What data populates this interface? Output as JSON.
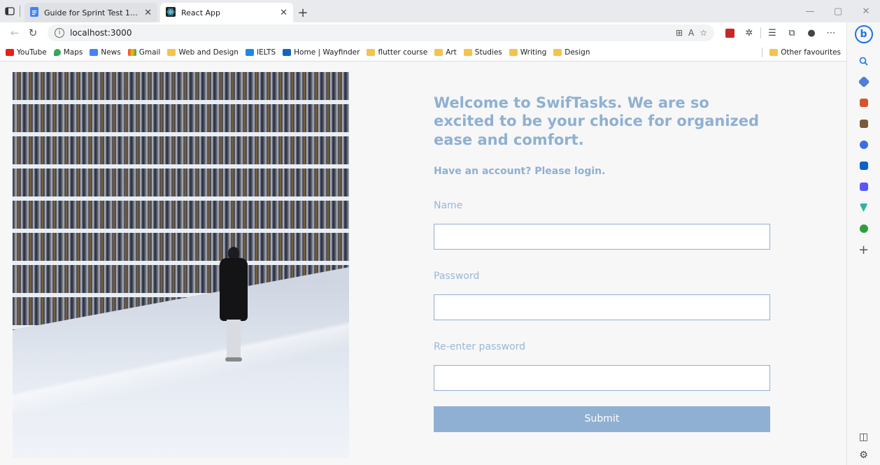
{
  "browser": {
    "tabs": [
      {
        "title": "Guide for Sprint Test 1 - Google D",
        "active": false
      },
      {
        "title": "React App",
        "active": true
      }
    ],
    "address": "localhost:3000",
    "bookmarks": [
      {
        "label": "YouTube",
        "icon": "youtube-icon",
        "color": "#e62117"
      },
      {
        "label": "Maps",
        "icon": "maps-icon",
        "color": "#34a853"
      },
      {
        "label": "News",
        "icon": "news-icon",
        "color": "#4285f4"
      },
      {
        "label": "Gmail",
        "icon": "gmail-icon",
        "color": "#ea4335"
      },
      {
        "label": "Web and Design",
        "icon": "folder-icon",
        "color": "#f5c34a"
      },
      {
        "label": "IELTS",
        "icon": "ielts-icon",
        "color": "#1e88e5"
      },
      {
        "label": "Home | Wayfinder",
        "icon": "wayfinder-icon",
        "color": "#1565c0"
      },
      {
        "label": "flutter course",
        "icon": "folder-icon",
        "color": "#f5c34a"
      },
      {
        "label": "Art",
        "icon": "folder-icon",
        "color": "#f5c34a"
      },
      {
        "label": "Studies",
        "icon": "folder-icon",
        "color": "#f5c34a"
      },
      {
        "label": "Writing",
        "icon": "folder-icon",
        "color": "#f5c34a"
      },
      {
        "label": "Design",
        "icon": "folder-icon",
        "color": "#f5c34a"
      }
    ],
    "other_favourites": "Other favourites"
  },
  "form": {
    "welcome": "Welcome to SwifTasks. We are so excited to be your choice for organized ease and comfort.",
    "subheading": "Have an account? Please login.",
    "name_label": "Name",
    "name_value": "",
    "password_label": "Password",
    "password_value": "",
    "reenter_label": "Re-enter password",
    "reenter_value": "",
    "submit_label": "Submit"
  },
  "colors": {
    "accent": "#8fb0d2",
    "page_bg": "#f7f7f8"
  }
}
